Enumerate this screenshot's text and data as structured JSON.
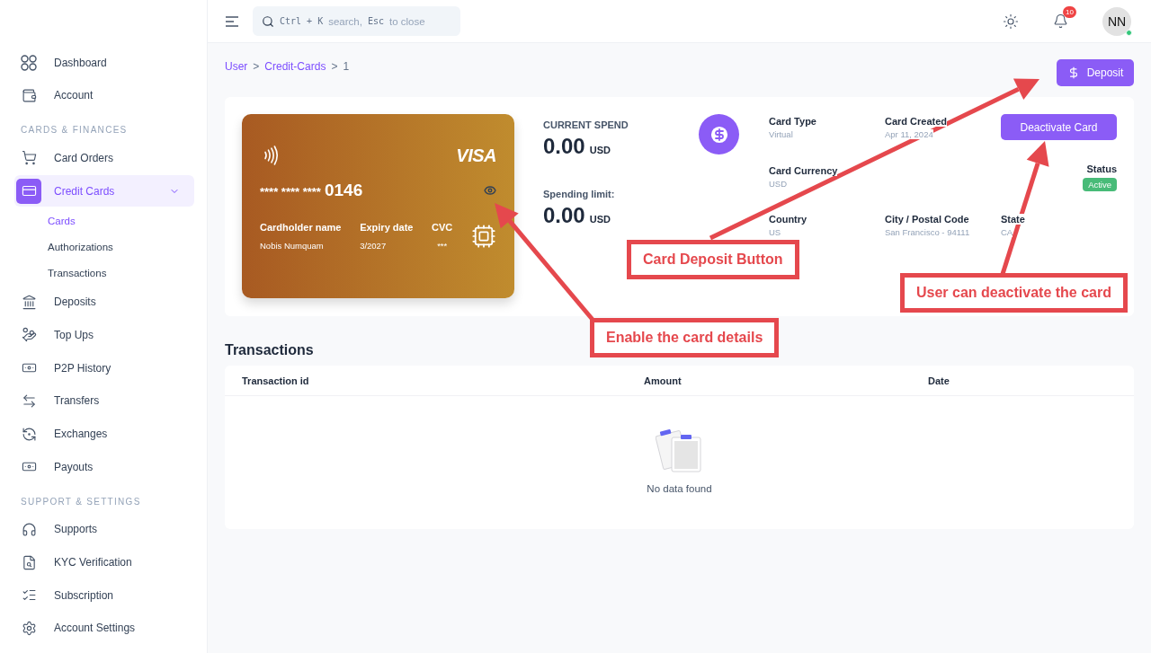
{
  "sidebar": {
    "items": [
      {
        "kind": "item",
        "label": "Dashboard",
        "selected": false
      },
      {
        "kind": "item",
        "label": "Account",
        "selected": false
      },
      {
        "kind": "section",
        "label": "CARDS & FINANCES"
      },
      {
        "kind": "item",
        "label": "Card Orders",
        "selected": false
      },
      {
        "kind": "item",
        "label": "Credit Cards",
        "selected": true,
        "expanded": true,
        "children": [
          {
            "label": "Cards",
            "selected": true
          },
          {
            "label": "Authorizations",
            "selected": false
          },
          {
            "label": "Transactions",
            "selected": false
          }
        ]
      },
      {
        "kind": "item",
        "label": "Deposits",
        "selected": false
      },
      {
        "kind": "item",
        "label": "Top Ups",
        "selected": false
      },
      {
        "kind": "item",
        "label": "P2P History",
        "selected": false
      },
      {
        "kind": "item",
        "label": "Transfers",
        "selected": false
      },
      {
        "kind": "item",
        "label": "Exchanges",
        "selected": false
      },
      {
        "kind": "item",
        "label": "Payouts",
        "selected": false
      },
      {
        "kind": "section",
        "label": "SUPPORT & SETTINGS"
      },
      {
        "kind": "item",
        "label": "Supports",
        "selected": false
      },
      {
        "kind": "item",
        "label": "KYC Verification",
        "selected": false
      },
      {
        "kind": "item",
        "label": "Subscription",
        "selected": false
      },
      {
        "kind": "item",
        "label": "Account Settings",
        "selected": false
      }
    ]
  },
  "topbar": {
    "search": {
      "hint_parts": [
        {
          "kind": "key",
          "text": "Ctrl + K"
        },
        {
          "kind": "text",
          "text": "search,"
        },
        {
          "kind": "key",
          "text": "Esc"
        },
        {
          "kind": "text",
          "text": "to close"
        }
      ]
    },
    "notifications": "10",
    "avatar": {
      "initials": "NN",
      "online": true
    }
  },
  "breadcrumb": [
    {
      "label": "User",
      "link": true
    },
    {
      "label": ">",
      "link": false
    },
    {
      "label": "Credit-Cards",
      "link": true
    },
    {
      "label": ">",
      "link": false
    },
    {
      "label": "1",
      "link": false
    }
  ],
  "deposit_button": "Deposit",
  "card": {
    "brand": "VISA",
    "number_mask": "**** **** ****",
    "number_last": "0146",
    "holder_label": "Cardholder name",
    "holder": "Nobis Numquam",
    "expiry_label": "Expiry date",
    "expiry": "3/2027",
    "cvc_label": "CVC",
    "cvc": "***"
  },
  "spend": [
    {
      "label": "CURRENT SPEND",
      "amount": "0.00",
      "currency": "USD"
    },
    {
      "label": "Spending limit:",
      "amount": "0.00",
      "currency": "USD"
    }
  ],
  "details": {
    "fields": [
      {
        "label": "Card Type",
        "value": "Virtual"
      },
      {
        "label": "Card Created",
        "value": "Apr 11, 2024"
      },
      {
        "label": "Card Currency",
        "value": "USD"
      },
      {
        "label": "Country",
        "value": "US"
      },
      {
        "label": "City / Postal Code",
        "value": "San Francisco - 94111"
      },
      {
        "label": "State",
        "value": "CA"
      }
    ],
    "deactivate_button": "Deactivate Card",
    "status": {
      "label": "Status",
      "value": "Active"
    }
  },
  "transactions": {
    "title": "Transactions",
    "columns": [
      "Transaction id",
      "Amount",
      "Date"
    ],
    "empty_text": "No data found"
  },
  "annotations": [
    {
      "text": "Card Deposit Button"
    },
    {
      "text": "User can deactivate the card"
    },
    {
      "text": "Enable the card details"
    }
  ]
}
